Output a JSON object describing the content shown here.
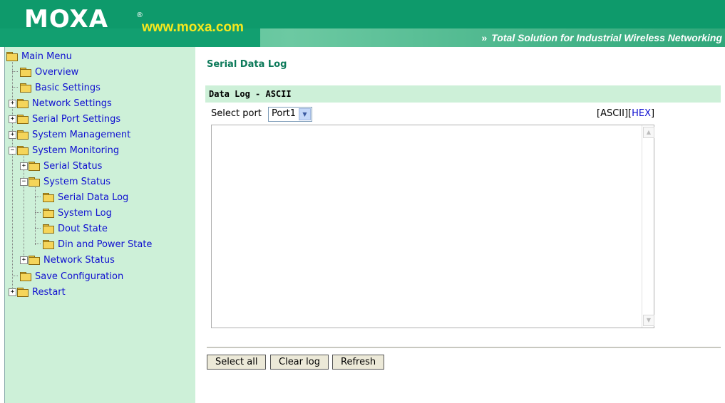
{
  "header": {
    "logo": "MOXA",
    "registered": "®",
    "url": "www.moxa.com",
    "tagline_arrows": "»",
    "tagline": "Total Solution for Industrial Wireless Networking"
  },
  "tree": {
    "root": "Main Menu",
    "overview": "Overview",
    "basic_settings": "Basic Settings",
    "network_settings": "Network Settings",
    "serial_port_settings": "Serial Port Settings",
    "system_management": "System Management",
    "system_monitoring": "System Monitoring",
    "serial_status": "Serial Status",
    "system_status": "System Status",
    "serial_data_log": "Serial Data Log",
    "system_log": "System Log",
    "dout_state": "Dout State",
    "din_power_state": "Din and Power State",
    "network_status": "Network Status",
    "save_configuration": "Save Configuration",
    "restart": "Restart"
  },
  "main": {
    "page_title": "Serial Data Log",
    "section_title": "Data Log - ASCII",
    "select_label": "Select port",
    "selected_port": "Port1",
    "format_open": "[ASCII][",
    "format_hex": "HEX",
    "format_close": "]",
    "buttons": {
      "select_all": "Select all",
      "clear_log": "Clear log",
      "refresh": "Refresh"
    }
  },
  "colors": {
    "header_green": "#0e9a6b",
    "panel_green": "#cdf0d8",
    "link_blue": "#1010d0",
    "url_yellow": "#f6e81e"
  }
}
